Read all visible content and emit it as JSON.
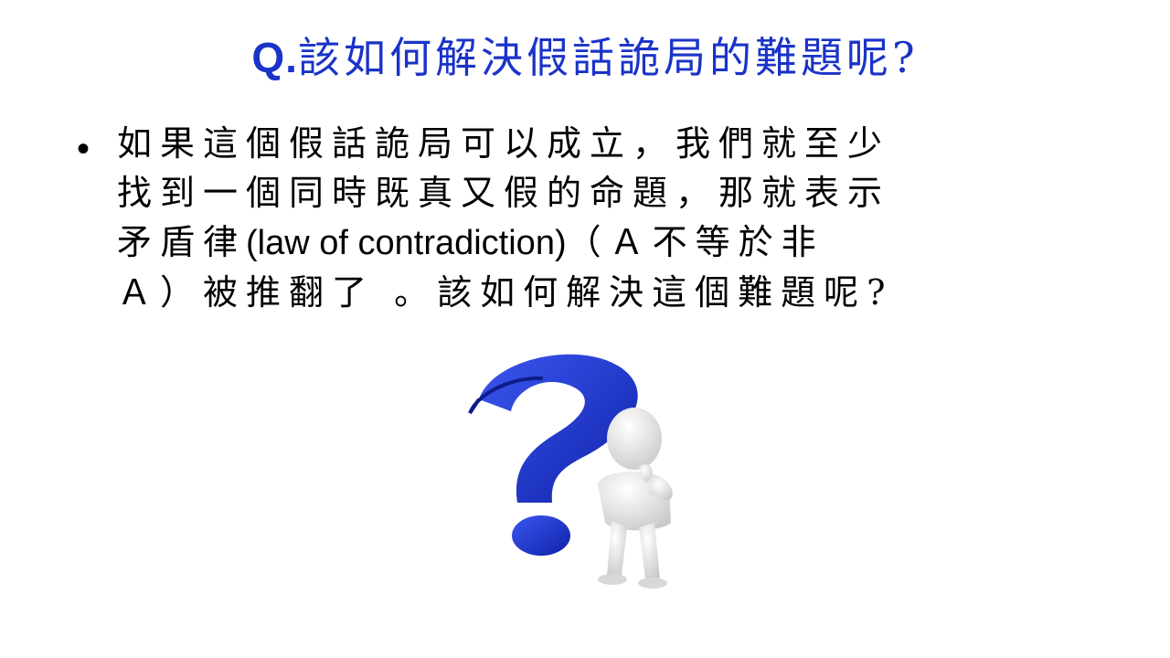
{
  "slide": {
    "title_prefix": "Q.",
    "title_main": "該如何解決假話詭局的難題呢?",
    "bullet": {
      "marker": "•",
      "lines": [
        "如果這個假話詭局可以成立，我們就至少",
        "找到一個同時既真又假的命題，那就表示",
        "矛盾律",
        "(law of contradiction)",
        "（Ａ不等於非",
        "Ａ）被推翻了 。該如何解決這個難題呢?"
      ]
    },
    "figure": {
      "icon": "thinking-person-question-mark",
      "colors": {
        "question_mark": "#1f3bd6",
        "figure_body": "#e6e6e6"
      }
    }
  }
}
